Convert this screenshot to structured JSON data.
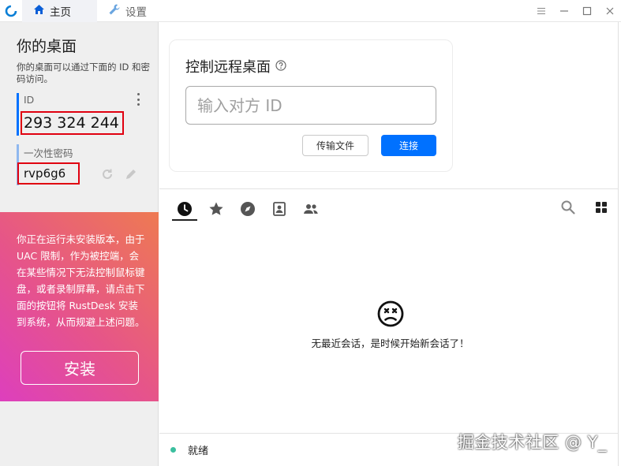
{
  "titlebar": {
    "tabs": [
      {
        "label": "主页",
        "icon": "home-icon"
      },
      {
        "label": "设置",
        "icon": "wrench-icon"
      }
    ],
    "controls": [
      "menu-icon",
      "minimize-icon",
      "maximize-icon",
      "close-icon"
    ]
  },
  "left": {
    "title": "你的桌面",
    "description": "你的桌面可以通过下面的 ID 和密码访问。",
    "id_label": "ID",
    "id_value": "293 324 244",
    "password_label": "一次性密码",
    "password_value": "rvp6g6",
    "install_card": {
      "text": "你正在运行未安装版本，由于 UAC 限制，作为被控端，会在某些情况下无法控制鼠标键盘，或者录制屏幕，请点击下面的按钮将 RustDesk 安装到系统，从而规避上述问题。",
      "button_label": "安装"
    }
  },
  "right": {
    "control_title": "控制远程桌面",
    "input_placeholder": "输入对方 ID",
    "transfer_button": "传输文件",
    "connect_button": "连接",
    "peer_tabs": [
      "recent-icon",
      "favorites-icon",
      "discovered-icon",
      "address-book-icon",
      "group-icon"
    ],
    "empty_message": "无最近会话，是时候开始新会话了！",
    "status": "就绪",
    "watermark": "掘金技术社区 @ Y_"
  },
  "colors": {
    "accent": "#0071ff",
    "status_ok": "#3bbf9f",
    "highlight_box": "#e00010"
  }
}
